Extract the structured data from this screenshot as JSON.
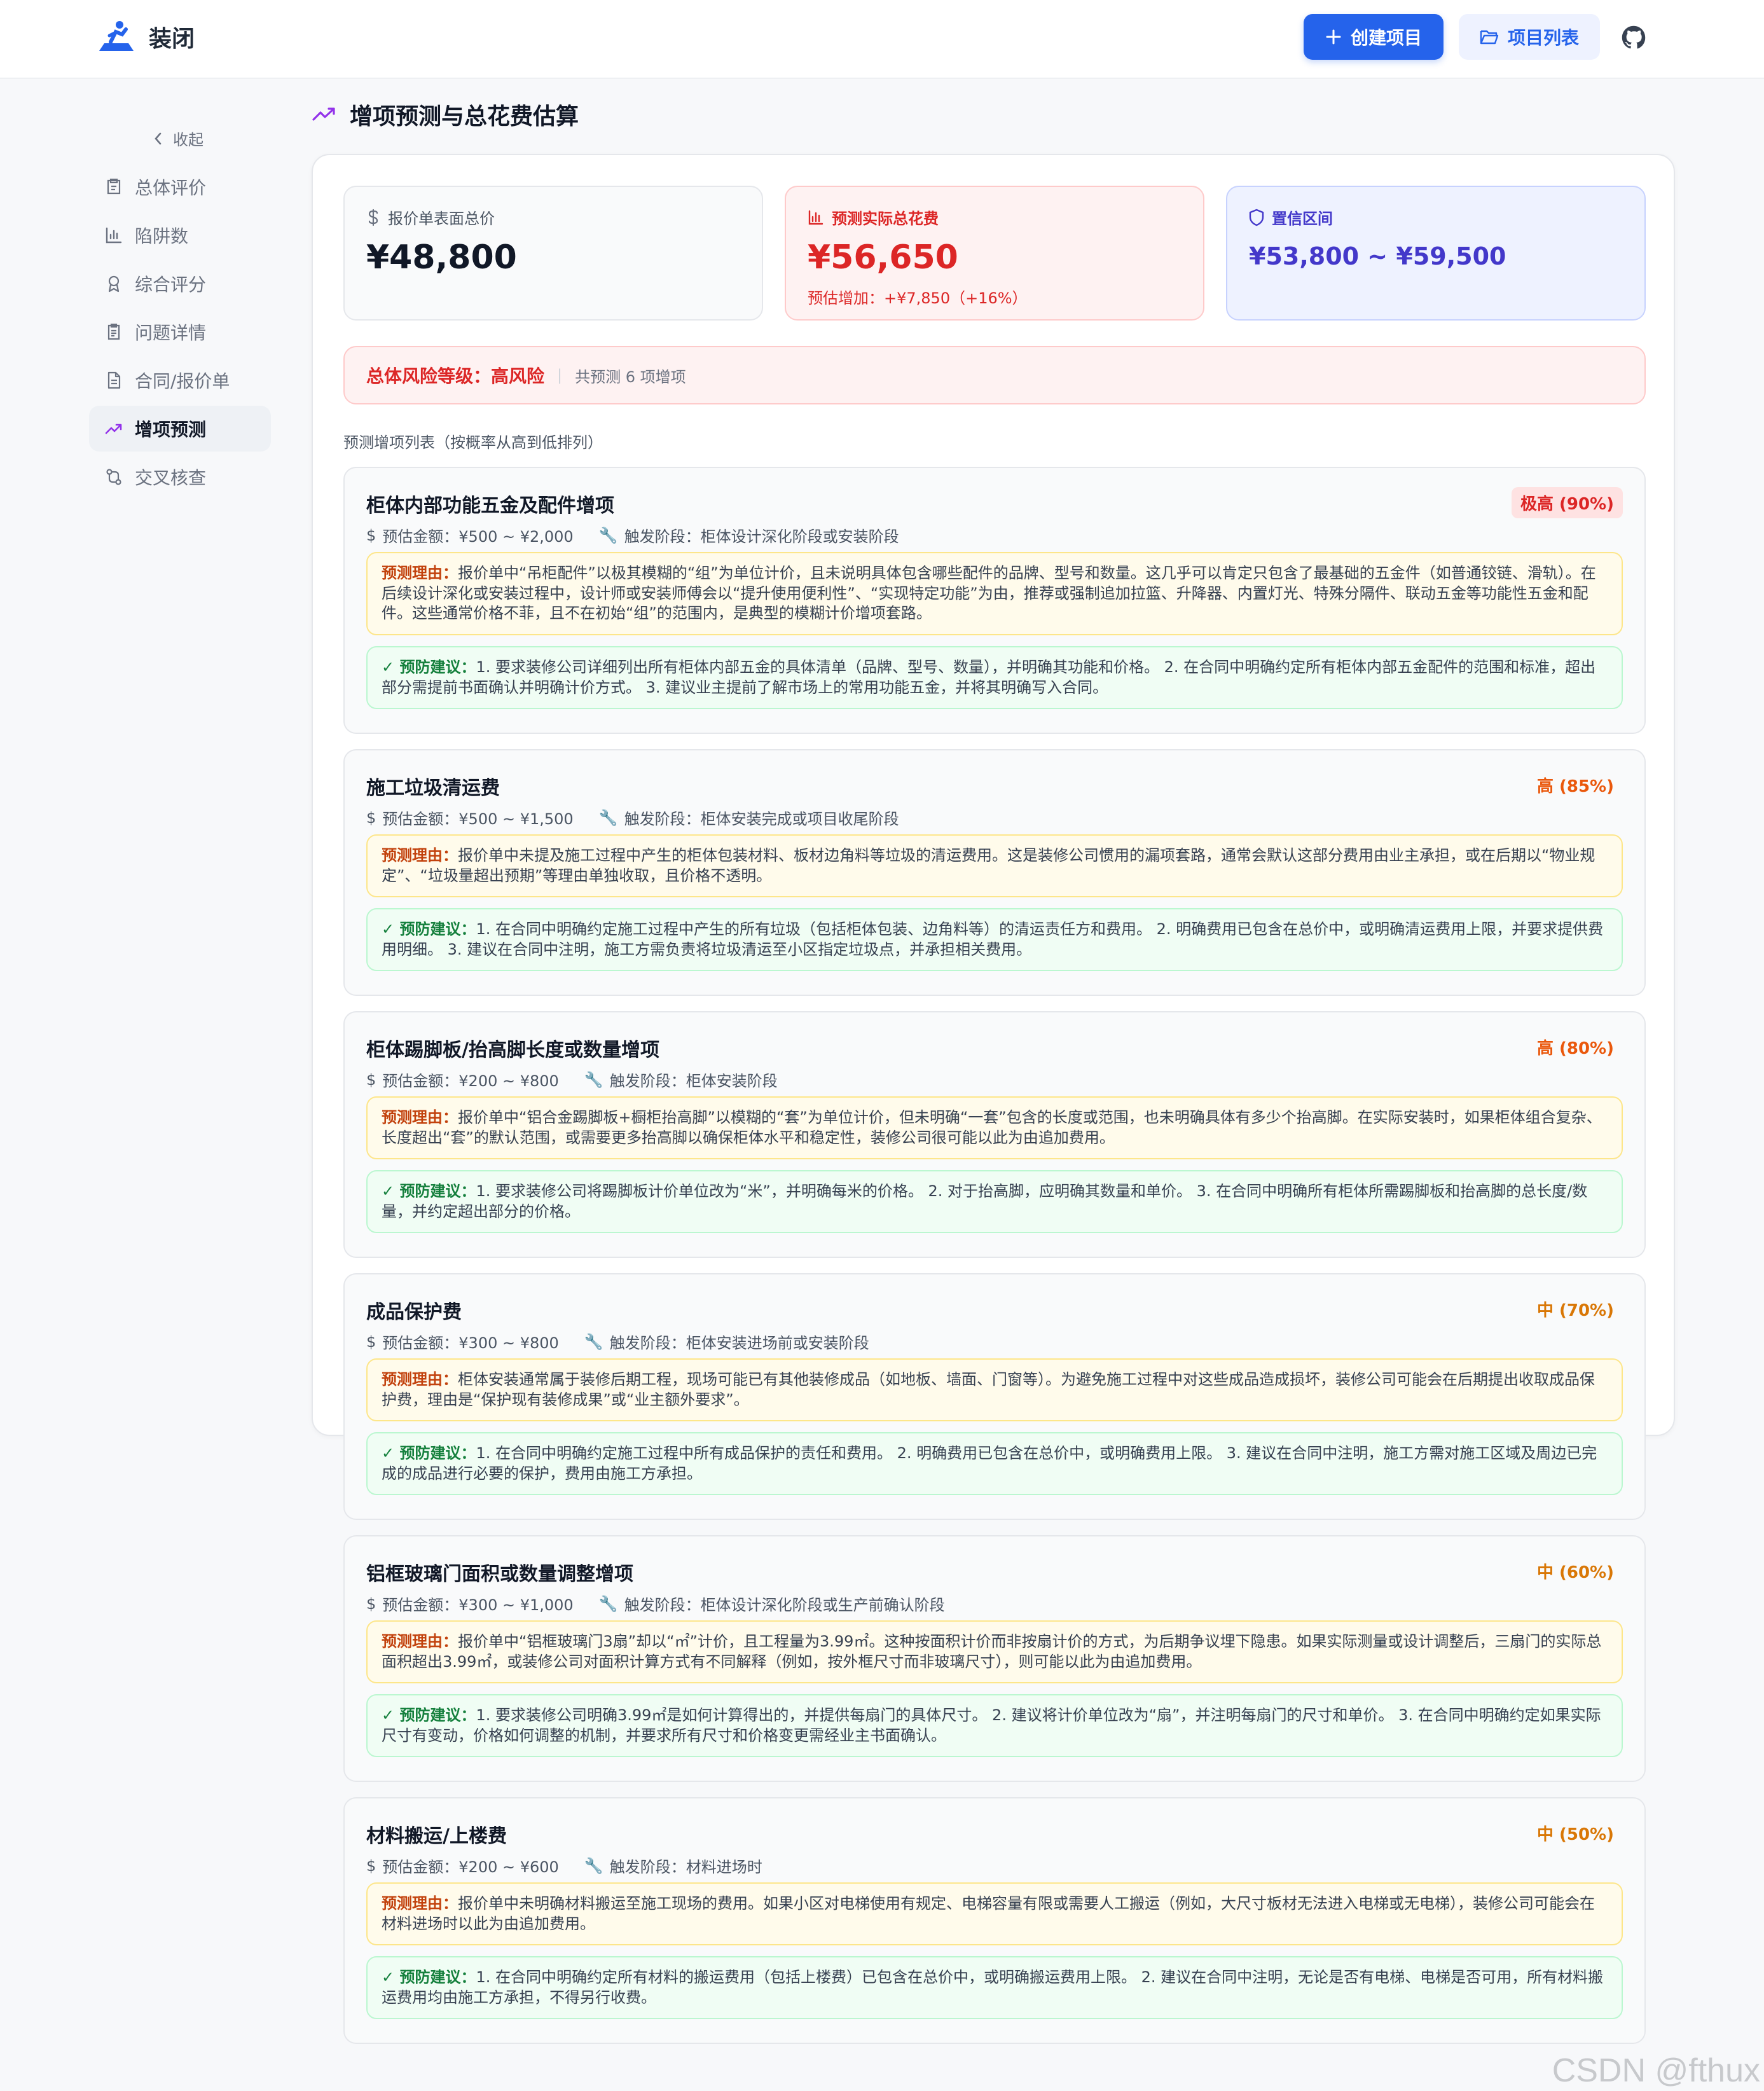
{
  "app": {
    "name": "装闭",
    "create_label": "创建项目",
    "list_label": "项目列表"
  },
  "sidebar": {
    "collapse_label": "收起",
    "items": [
      {
        "label": "总体评价",
        "icon": "clipboard-icon"
      },
      {
        "label": "陷阱数",
        "icon": "bar-chart-icon"
      },
      {
        "label": "综合评分",
        "icon": "award-icon"
      },
      {
        "label": "问题详情",
        "icon": "file-list-icon"
      },
      {
        "label": "合同/报价单",
        "icon": "document-icon"
      },
      {
        "label": "增项预测",
        "icon": "trend-icon",
        "active": true
      },
      {
        "label": "交叉核查",
        "icon": "git-compare-icon"
      }
    ]
  },
  "page": {
    "title": "增项预测与总花费估算"
  },
  "stats": {
    "quote_label": "报价单表面总价",
    "quote_value": "¥48,800",
    "predicted_label": "预测实际总花费",
    "predicted_value": "¥56,650",
    "predicted_sub": "预估增加：+¥7,850（+16%）",
    "interval_label": "置信区间",
    "interval_value": "¥53,800 ~ ¥59,500"
  },
  "risk": {
    "label": "总体风险等级：高风险",
    "count": "共预测 6 项增项"
  },
  "list_title": "预测增项列表（按概率从高到低排列）",
  "items": [
    {
      "title": "柜体内部功能五金及配件增项",
      "badge": "极高 (90%)",
      "amount": "预估金额：¥500 ~ ¥2,000",
      "stage": "触发阶段：柜体设计深化阶段或安装阶段",
      "reason_key": "预测理由：",
      "reason": "报价单中“吊柜配件”以极其模糊的“组”为单位计价，且未说明具体包含哪些配件的品牌、型号和数量。这几乎可以肯定只包含了最基础的五金件（如普通铰链、滑轨）。在后续设计深化或安装过程中，设计师或安装师傅会以“提升使用便利性”、“实现特定功能”为由，推荐或强制追加拉篮、升降器、内置灯光、特殊分隔件、联动五金等功能性五金和配件。这些通常价格不菲，且不在初始“组”的范围内，是典型的模糊计价增项套路。",
      "advice_key": "✓ 预防建议：",
      "advice": "1. 要求装修公司详细列出所有柜体内部五金的具体清单（品牌、型号、数量），并明确其功能和价格。 2. 在合同中明确约定所有柜体内部五金配件的范围和标准，超出部分需提前书面确认并明确计价方式。 3. 建议业主提前了解市场上的常用功能五金，并将其明确写入合同。"
    },
    {
      "title": "施工垃圾清运费",
      "badge": "高 (85%)",
      "amount": "预估金额：¥500 ~ ¥1,500",
      "stage": "触发阶段：柜体安装完成或项目收尾阶段",
      "reason_key": "预测理由：",
      "reason": "报价单中未提及施工过程中产生的柜体包装材料、板材边角料等垃圾的清运费用。这是装修公司惯用的漏项套路，通常会默认这部分费用由业主承担，或在后期以“物业规定”、“垃圾量超出预期”等理由单独收取，且价格不透明。",
      "advice_key": "✓ 预防建议：",
      "advice": "1. 在合同中明确约定施工过程中产生的所有垃圾（包括柜体包装、边角料等）的清运责任方和费用。 2. 明确费用已包含在总价中，或明确清运费用上限，并要求提供费用明细。 3. 建议在合同中注明，施工方需负责将垃圾清运至小区指定垃圾点，并承担相关费用。"
    },
    {
      "title": "柜体踢脚板/抬高脚长度或数量增项",
      "badge": "高 (80%)",
      "amount": "预估金额：¥200 ~ ¥800",
      "stage": "触发阶段：柜体安装阶段",
      "reason_key": "预测理由：",
      "reason": "报价单中“铝合金踢脚板+橱柜抬高脚”以模糊的“套”为单位计价，但未明确“一套”包含的长度或范围，也未明确具体有多少个抬高脚。在实际安装时，如果柜体组合复杂、长度超出“套”的默认范围，或需要更多抬高脚以确保柜体水平和稳定性，装修公司很可能以此为由追加费用。",
      "advice_key": "✓ 预防建议：",
      "advice": "1. 要求装修公司将踢脚板计价单位改为“米”，并明确每米的价格。 2. 对于抬高脚，应明确其数量和单价。 3. 在合同中明确所有柜体所需踢脚板和抬高脚的总长度/数量，并约定超出部分的价格。"
    },
    {
      "title": "成品保护费",
      "badge": "中 (70%)",
      "amount": "预估金额：¥300 ~ ¥800",
      "stage": "触发阶段：柜体安装进场前或安装阶段",
      "reason_key": "预测理由：",
      "reason": "柜体安装通常属于装修后期工程，现场可能已有其他装修成品（如地板、墙面、门窗等）。为避免施工过程中对这些成品造成损坏，装修公司可能会在后期提出收取成品保护费，理由是“保护现有装修成果”或“业主额外要求”。",
      "advice_key": "✓ 预防建议：",
      "advice": "1. 在合同中明确约定施工过程中所有成品保护的责任和费用。 2. 明确费用已包含在总价中，或明确费用上限。 3. 建议在合同中注明，施工方需对施工区域及周边已完成的成品进行必要的保护，费用由施工方承担。"
    },
    {
      "title": "铝框玻璃门面积或数量调整增项",
      "badge": "中 (60%)",
      "amount": "预估金额：¥300 ~ ¥1,000",
      "stage": "触发阶段：柜体设计深化阶段或生产前确认阶段",
      "reason_key": "预测理由：",
      "reason": "报价单中“铝框玻璃门3扇”却以“㎡”计价，且工程量为3.99㎡。这种按面积计价而非按扇计价的方式，为后期争议埋下隐患。如果实际测量或设计调整后，三扇门的实际总面积超出3.99㎡，或装修公司对面积计算方式有不同解释（例如，按外框尺寸而非玻璃尺寸），则可能以此为由追加费用。",
      "advice_key": "✓ 预防建议：",
      "advice": "1. 要求装修公司明确3.99㎡是如何计算得出的，并提供每扇门的具体尺寸。 2. 建议将计价单位改为“扇”，并注明每扇门的尺寸和单价。 3. 在合同中明确约定如果实际尺寸有变动，价格如何调整的机制，并要求所有尺寸和价格变更需经业主书面确认。"
    },
    {
      "title": "材料搬运/上楼费",
      "badge": "中 (50%)",
      "amount": "预估金额：¥200 ~ ¥600",
      "stage": "触发阶段：材料进场时",
      "reason_key": "预测理由：",
      "reason": "报价单中未明确材料搬运至施工现场的费用。如果小区对电梯使用有规定、电梯容量有限或需要人工搬运（例如，大尺寸板材无法进入电梯或无电梯），装修公司可能会在材料进场时以此为由追加费用。",
      "advice_key": "✓ 预防建议：",
      "advice": "1. 在合同中明确约定所有材料的搬运费用（包括上楼费）已包含在总价中，或明确搬运费用上限。 2. 建议在合同中注明，无论是否有电梯、电梯是否可用，所有材料搬运费用均由施工方承担，不得另行收费。"
    }
  ],
  "watermark": "CSDN @fthux",
  "colors": {
    "accent": "#2563eb",
    "danger": "#dc2626",
    "indigo": "#4338ca",
    "warning": "#d97706"
  }
}
